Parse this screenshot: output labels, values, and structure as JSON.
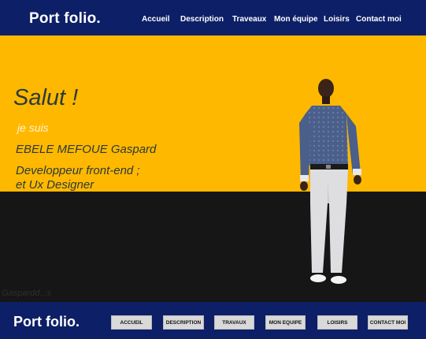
{
  "header": {
    "brand": "Port folio.",
    "nav": [
      "Accueil",
      "Description",
      "Traveaux",
      "Mon équipe",
      "Loisirs",
      "Contact moi"
    ]
  },
  "hero": {
    "greeting": "Salut !",
    "intro": "je suis",
    "name": "EBELE MEFOUE Gaspard",
    "role_line1": "Developpeur front-end ;",
    "role_line2": "et Ux Designer",
    "faded_text": "Gaspardd...s"
  },
  "footer": {
    "brand": "Port folio.",
    "buttons": [
      "ACCUEIL",
      "DESCRIPTION",
      "TRAVAUX",
      "MON EQUIPE",
      "LOISIRS",
      "CONTACT MOI"
    ]
  },
  "colors": {
    "navy": "#0d1f66",
    "yellow": "#ffb800",
    "dark": "#161616"
  }
}
